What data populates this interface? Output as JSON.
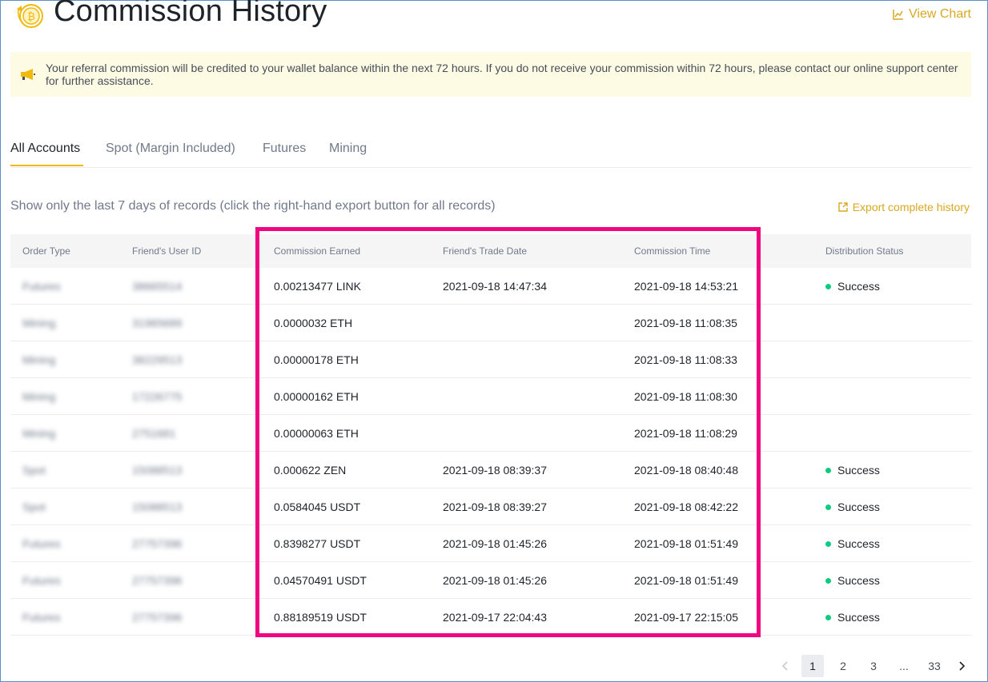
{
  "header": {
    "title": "Commission History",
    "view_chart_label": "View Chart"
  },
  "notice": {
    "text": "Your referral commission will be credited to your wallet balance within the next 72 hours. If you do not receive your commission within 72 hours, please contact our online support center for further assistance."
  },
  "tabs": [
    {
      "label": "All Accounts",
      "active": true
    },
    {
      "label": "Spot (Margin Included)",
      "active": false
    },
    {
      "label": "Futures",
      "active": false
    },
    {
      "label": "Mining",
      "active": false
    }
  ],
  "records_note": "Show only the last 7 days of records (click the right-hand export button for all records)",
  "export_label": "Export complete history",
  "table": {
    "headers": [
      "Order Type",
      "Friend's User ID",
      "Commission Earned",
      "Friend's Trade Date",
      "Commission Time",
      "Distribution Status"
    ],
    "rows": [
      {
        "order_type": "Futures",
        "user_id": "38665514",
        "commission": "0.00213477 LINK",
        "trade_date": "2021-09-18 14:47:34",
        "commission_time": "2021-09-18 14:53:21",
        "status": "Success"
      },
      {
        "order_type": "Mining",
        "user_id": "31965689",
        "commission": "0.0000032 ETH",
        "trade_date": "",
        "commission_time": "2021-09-18 11:08:35",
        "status": ""
      },
      {
        "order_type": "Mining",
        "user_id": "38229513",
        "commission": "0.00000178 ETH",
        "trade_date": "",
        "commission_time": "2021-09-18 11:08:33",
        "status": ""
      },
      {
        "order_type": "Mining",
        "user_id": "17226775",
        "commission": "0.00000162 ETH",
        "trade_date": "",
        "commission_time": "2021-09-18 11:08:30",
        "status": ""
      },
      {
        "order_type": "Mining",
        "user_id": "2751681",
        "commission": "0.00000063 ETH",
        "trade_date": "",
        "commission_time": "2021-09-18 11:08:29",
        "status": ""
      },
      {
        "order_type": "Spot",
        "user_id": "15088513",
        "commission": "0.000622 ZEN",
        "trade_date": "2021-09-18 08:39:37",
        "commission_time": "2021-09-18 08:40:48",
        "status": "Success"
      },
      {
        "order_type": "Spot",
        "user_id": "15088513",
        "commission": "0.0584045 USDT",
        "trade_date": "2021-09-18 08:39:27",
        "commission_time": "2021-09-18 08:42:22",
        "status": "Success"
      },
      {
        "order_type": "Futures",
        "user_id": "27757396",
        "commission": "0.8398277 USDT",
        "trade_date": "2021-09-18 01:45:26",
        "commission_time": "2021-09-18 01:51:49",
        "status": "Success"
      },
      {
        "order_type": "Futures",
        "user_id": "27757396",
        "commission": "0.04570491 USDT",
        "trade_date": "2021-09-18 01:45:26",
        "commission_time": "2021-09-18 01:51:49",
        "status": "Success"
      },
      {
        "order_type": "Futures",
        "user_id": "27757396",
        "commission": "0.88189519 USDT",
        "trade_date": "2021-09-17 22:04:43",
        "commission_time": "2021-09-17 22:15:05",
        "status": "Success"
      }
    ]
  },
  "pagination": {
    "pages": [
      "1",
      "2",
      "3",
      "...",
      "33"
    ],
    "current": "1"
  },
  "colors": {
    "accent": "#f0b90b",
    "link": "#d9a821",
    "success": "#0ecb81",
    "highlight": "#f0077f",
    "notice_bg": "#fefbe5"
  },
  "icons": {
    "logo": "bitcoin-coin-icon",
    "notice": "megaphone-icon",
    "view_chart": "line-chart-icon",
    "export": "export-icon",
    "prev": "chevron-left-icon",
    "next": "chevron-right-icon"
  }
}
